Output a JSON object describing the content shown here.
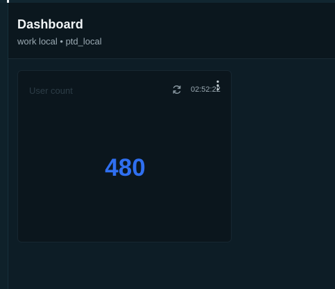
{
  "header": {
    "title": "Dashboard",
    "subtitle": "work local • ptd_local"
  },
  "card": {
    "title": "User count",
    "time": "02:52:22",
    "value": "480",
    "refresh_icon": "refresh-icon",
    "menu_icon": "kebab-menu-icon"
  },
  "colors": {
    "background": "#0d1d26",
    "header_bg": "#0b171e",
    "card_bg": "#0b161d",
    "metric": "#2f6ff0",
    "title_text": "#f1f5f7",
    "muted_text": "#9aa9b2"
  }
}
